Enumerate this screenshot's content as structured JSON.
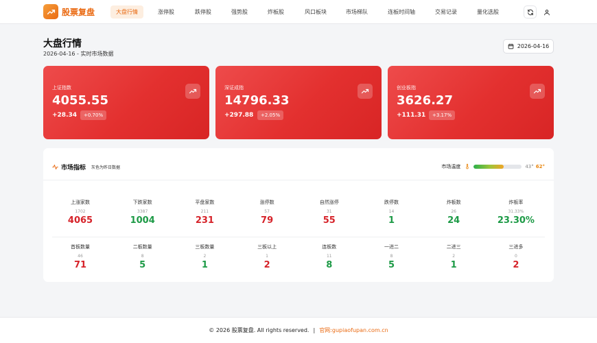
{
  "app": {
    "name": "股票复盘"
  },
  "nav": [
    {
      "label": "大盘行情",
      "active": true
    },
    {
      "label": "涨停股",
      "active": false
    },
    {
      "label": "跌停股",
      "active": false
    },
    {
      "label": "强势股",
      "active": false
    },
    {
      "label": "炸板股",
      "active": false
    },
    {
      "label": "风口板块",
      "active": false
    },
    {
      "label": "市场梯队",
      "active": false
    },
    {
      "label": "连板时间轴",
      "active": false
    },
    {
      "label": "交易记录",
      "active": false
    },
    {
      "label": "量化选股",
      "active": false
    }
  ],
  "header": {
    "title": "大盘行情",
    "subtitle": "2026-04-16 - 实时市场数据",
    "date": "2026-04-16"
  },
  "indices": [
    {
      "name": "上证指数",
      "value": "4055.55",
      "change": "+28.34",
      "pct": "+0.70%",
      "icon": "trending-up-icon"
    },
    {
      "name": "深证成指",
      "value": "14796.33",
      "change": "+297.88",
      "pct": "+2.05%",
      "icon": "trending-up-icon"
    },
    {
      "name": "创业板指",
      "value": "3626.27",
      "change": "+111.31",
      "pct": "+3.17%",
      "icon": "trending-up-icon"
    }
  ],
  "indicators": {
    "title": "市场指标",
    "note": "灰色为昨日数据",
    "temp_label": "市场温度",
    "temp_prev": "43°",
    "temp_now": "62°",
    "temp_level": 0.62,
    "row1": [
      {
        "label": "上涨家数",
        "prev": "1702",
        "value": "4065",
        "color": "red"
      },
      {
        "label": "下跌家数",
        "prev": "3387",
        "value": "1004",
        "color": "green"
      },
      {
        "label": "平盘家数",
        "prev": "211",
        "value": "231",
        "color": "red"
      },
      {
        "label": "涨停数",
        "prev": "57",
        "value": "79",
        "color": "red"
      },
      {
        "label": "自然涨停",
        "prev": "31",
        "value": "55",
        "color": "red"
      },
      {
        "label": "跌停数",
        "prev": "14",
        "value": "1",
        "color": "green"
      },
      {
        "label": "炸板数",
        "prev": "26",
        "value": "24",
        "color": "green"
      },
      {
        "label": "炸板率",
        "prev": "31.33%",
        "value": "23.30%",
        "color": "green"
      }
    ],
    "row2": [
      {
        "label": "首板数量",
        "prev": "46",
        "value": "71",
        "color": "red"
      },
      {
        "label": "二板数量",
        "prev": "8",
        "value": "5",
        "color": "green"
      },
      {
        "label": "三板数量",
        "prev": "2",
        "value": "1",
        "color": "green"
      },
      {
        "label": "三板以上",
        "prev": "1",
        "value": "2",
        "color": "red"
      },
      {
        "label": "连板数",
        "prev": "11",
        "value": "8",
        "color": "green"
      },
      {
        "label": "一进二",
        "prev": "8",
        "value": "5",
        "color": "green"
      },
      {
        "label": "二进三",
        "prev": "2",
        "value": "1",
        "color": "green"
      },
      {
        "label": "三进多",
        "prev": "0",
        "value": "2",
        "color": "red"
      }
    ]
  },
  "footer": {
    "copyright": "© 2026 股票复盘. All rights reserved.",
    "separator": "|",
    "site_label": "官网:",
    "site_url": "gupiaofupan.com.cn"
  },
  "colors": {
    "accent": "#ea6a12",
    "up": "#d6232a",
    "down": "#1d9a46",
    "card": "#e3302f"
  }
}
